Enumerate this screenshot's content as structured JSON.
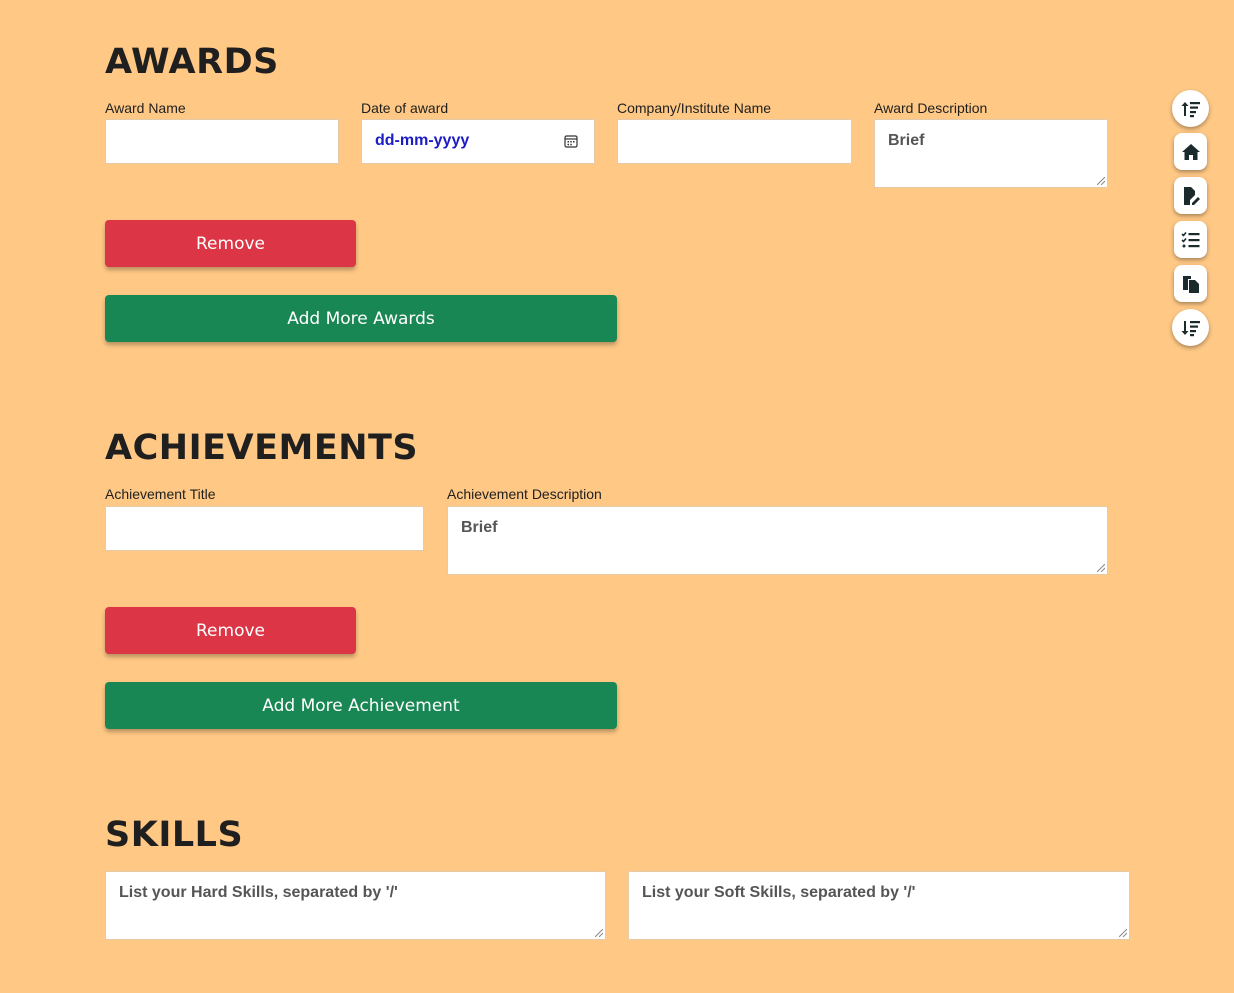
{
  "awards": {
    "heading": "AWARDS",
    "fields": {
      "name_label": "Award Name",
      "date_label": "Date of award",
      "date_placeholder": "dd-mm-yyyy",
      "company_label": "Company/Institute Name",
      "description_label": "Award Description",
      "description_placeholder": "Brief"
    },
    "remove_label": "Remove",
    "add_label": "Add More Awards"
  },
  "achievements": {
    "heading": "ACHIEVEMENTS",
    "fields": {
      "title_label": "Achievement Title",
      "description_label": "Achievement Description",
      "description_placeholder": "Brief"
    },
    "remove_label": "Remove",
    "add_label": "Add More Achievement"
  },
  "skills": {
    "heading": "SKILLS",
    "hard_placeholder": "List your Hard Skills, separated by '/'",
    "soft_placeholder": "List your Soft Skills, separated by '/'"
  },
  "side_nav": {
    "icons": [
      "sort-up-icon",
      "home-icon",
      "file-edit-icon",
      "checklist-icon",
      "copy-icon",
      "sort-down-icon"
    ]
  },
  "colors": {
    "background": "#ffc885",
    "remove": "#dc3545",
    "add": "#198754",
    "date_text": "#1c1cc4"
  }
}
